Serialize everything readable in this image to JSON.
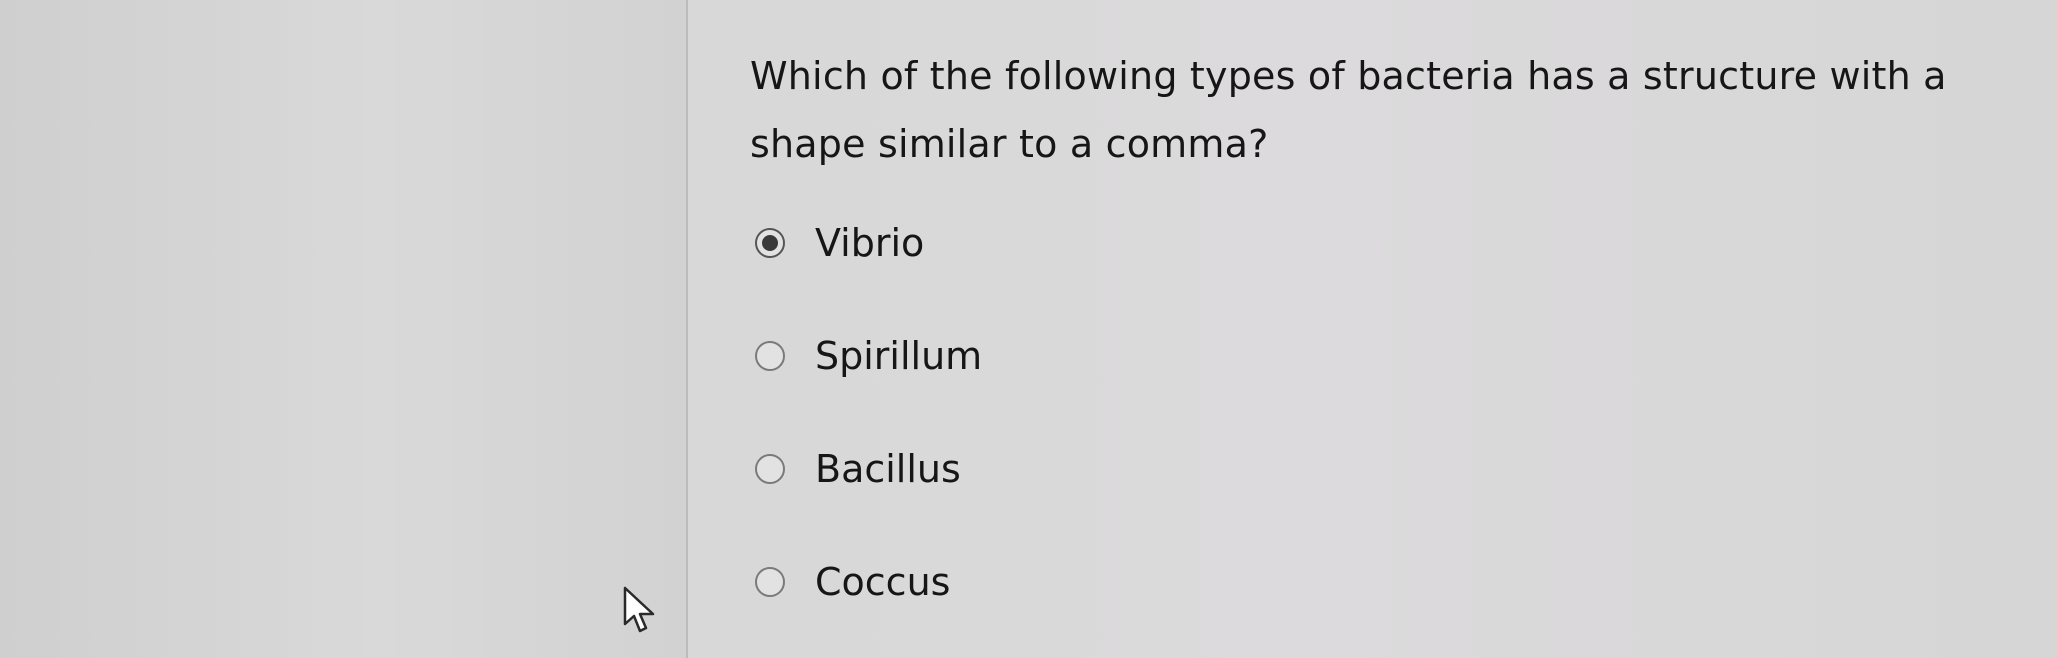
{
  "question": {
    "text": "Which of the following types of bacteria has a structure with a shape similar to a comma?"
  },
  "options": [
    {
      "label": "Vibrio",
      "selected": true
    },
    {
      "label": "Spirillum",
      "selected": false
    },
    {
      "label": "Bacillus",
      "selected": false
    },
    {
      "label": "Coccus",
      "selected": false
    }
  ],
  "icons": {
    "cursor": "mouse-pointer-icon"
  },
  "colors": {
    "text": "#161616",
    "radio_border": "#7a7a7a",
    "radio_selected_dot": "#3a3a3a"
  }
}
